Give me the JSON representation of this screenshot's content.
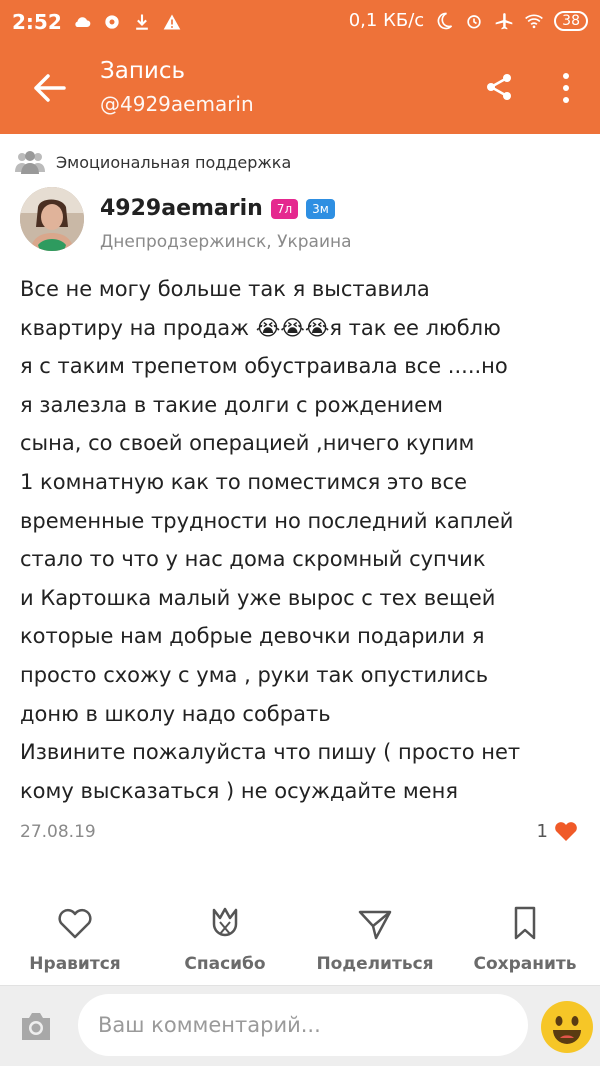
{
  "status_bar": {
    "time": "2:52",
    "network_speed": "0,1 КБ/с",
    "battery": "38"
  },
  "header": {
    "title": "Запись",
    "subtitle": "@4929aemarin"
  },
  "topic": {
    "label": "Эмоциональная поддержка"
  },
  "author": {
    "name": "4929aemarin",
    "badge_age": "7л",
    "badge_months": "3м",
    "location": "Днепродзержинск, Украина"
  },
  "post": {
    "text": "Все не могу больше так я выставила\nквартиру на продаж 😭😭😭я так ее люблю\nя с таким трепетом обустраивала все .....но\nя залезла в такие долги с рождением\nсына, со своей операцией ,ничего купим\n1 комнатную как то поместимся это все\nвременные трудности но последний каплей\nстало то что у нас дома скромный супчик\nи Картошка малый уже вырос с тех вещей\nкоторые нам добрые девочки подарили я\nпросто схожу с ума , руки так опустились\nдоню в школу надо собрать\nИзвините пожалуйста что пишу ( просто нет\nкому высказаться ) не осуждайте меня",
    "date": "27.08.19",
    "likes_count": "1"
  },
  "actions": {
    "like": "Нравится",
    "thanks": "Спасибо",
    "share": "Поделиться",
    "save": "Сохранить"
  },
  "comment": {
    "placeholder": "Ваш комментарий..."
  },
  "colors": {
    "accent": "#ee7239",
    "heart": "#f05a28",
    "badge_pink": "#e5288f",
    "badge_blue": "#2e8fe2"
  }
}
